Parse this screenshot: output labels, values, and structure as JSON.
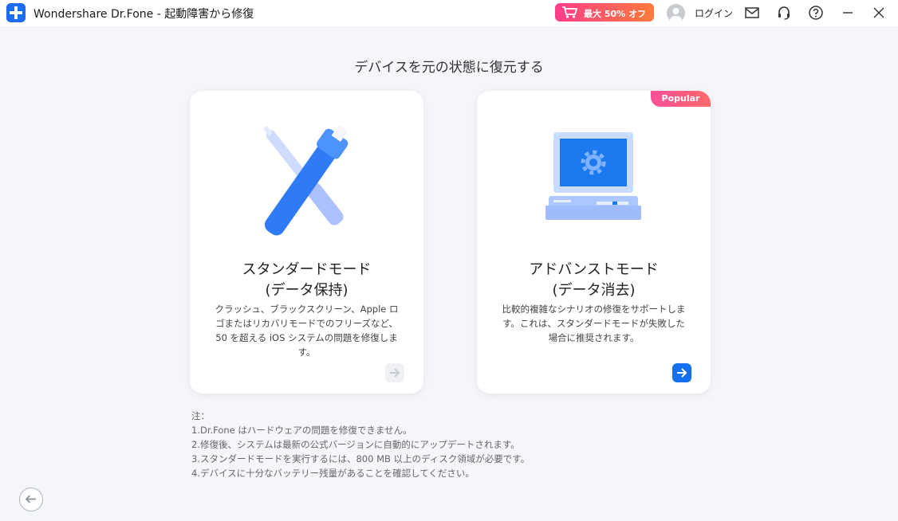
{
  "titlebar": {
    "app_title": "Wondershare Dr.Fone - 起動障害から修復",
    "promo_label": "最大 50% オフ",
    "login_label": "ログイン",
    "icons": [
      "logo-plus-icon",
      "cart-icon",
      "avatar-icon",
      "mail-icon",
      "headset-icon",
      "help-icon",
      "minimize-icon",
      "close-icon"
    ]
  },
  "main": {
    "title": "デバイスを元の状態に復元する"
  },
  "cards": [
    {
      "title_line1": "スタンダードモード",
      "title_line2": "(データ保持)",
      "desc_line1": "クラッシュ、ブラックスクリーン、Apple ロ",
      "desc_line2": "ゴまたはリカバリモードでのフリーズなど、",
      "desc_line3": "50 を超える iOS システムの問題を修復しま",
      "desc_line4": "す。",
      "icon": "tools-icon"
    },
    {
      "badge": "Popular",
      "title_line1": "アドバンストモード",
      "title_line2": "(データ消去)",
      "desc_line1": "比較的複雑なシナリオの修復をサポートしま",
      "desc_line2": "す。これは、スタンダードモードが失敗した",
      "desc_line3": "場合に推奨されます。",
      "icon": "computer-gear-icon"
    }
  ],
  "notes": {
    "heading": "注：",
    "items": [
      "1.Dr.Fone はハードウェアの問題を修復できません。",
      "2.修復後、システムは最新の公式バージョンに自動的にアップデートされます。",
      "3.スタンダードモードを実行するには、800 MB 以上のディスク領域が必要です。",
      "4.デバイスに十分なバッテリー残量があることを確認してください。"
    ]
  },
  "colors": {
    "accent": "#1570ef",
    "promo_start": "#ff3d8a",
    "promo_end": "#ff7a3a",
    "background": "#f4f6fa"
  }
}
